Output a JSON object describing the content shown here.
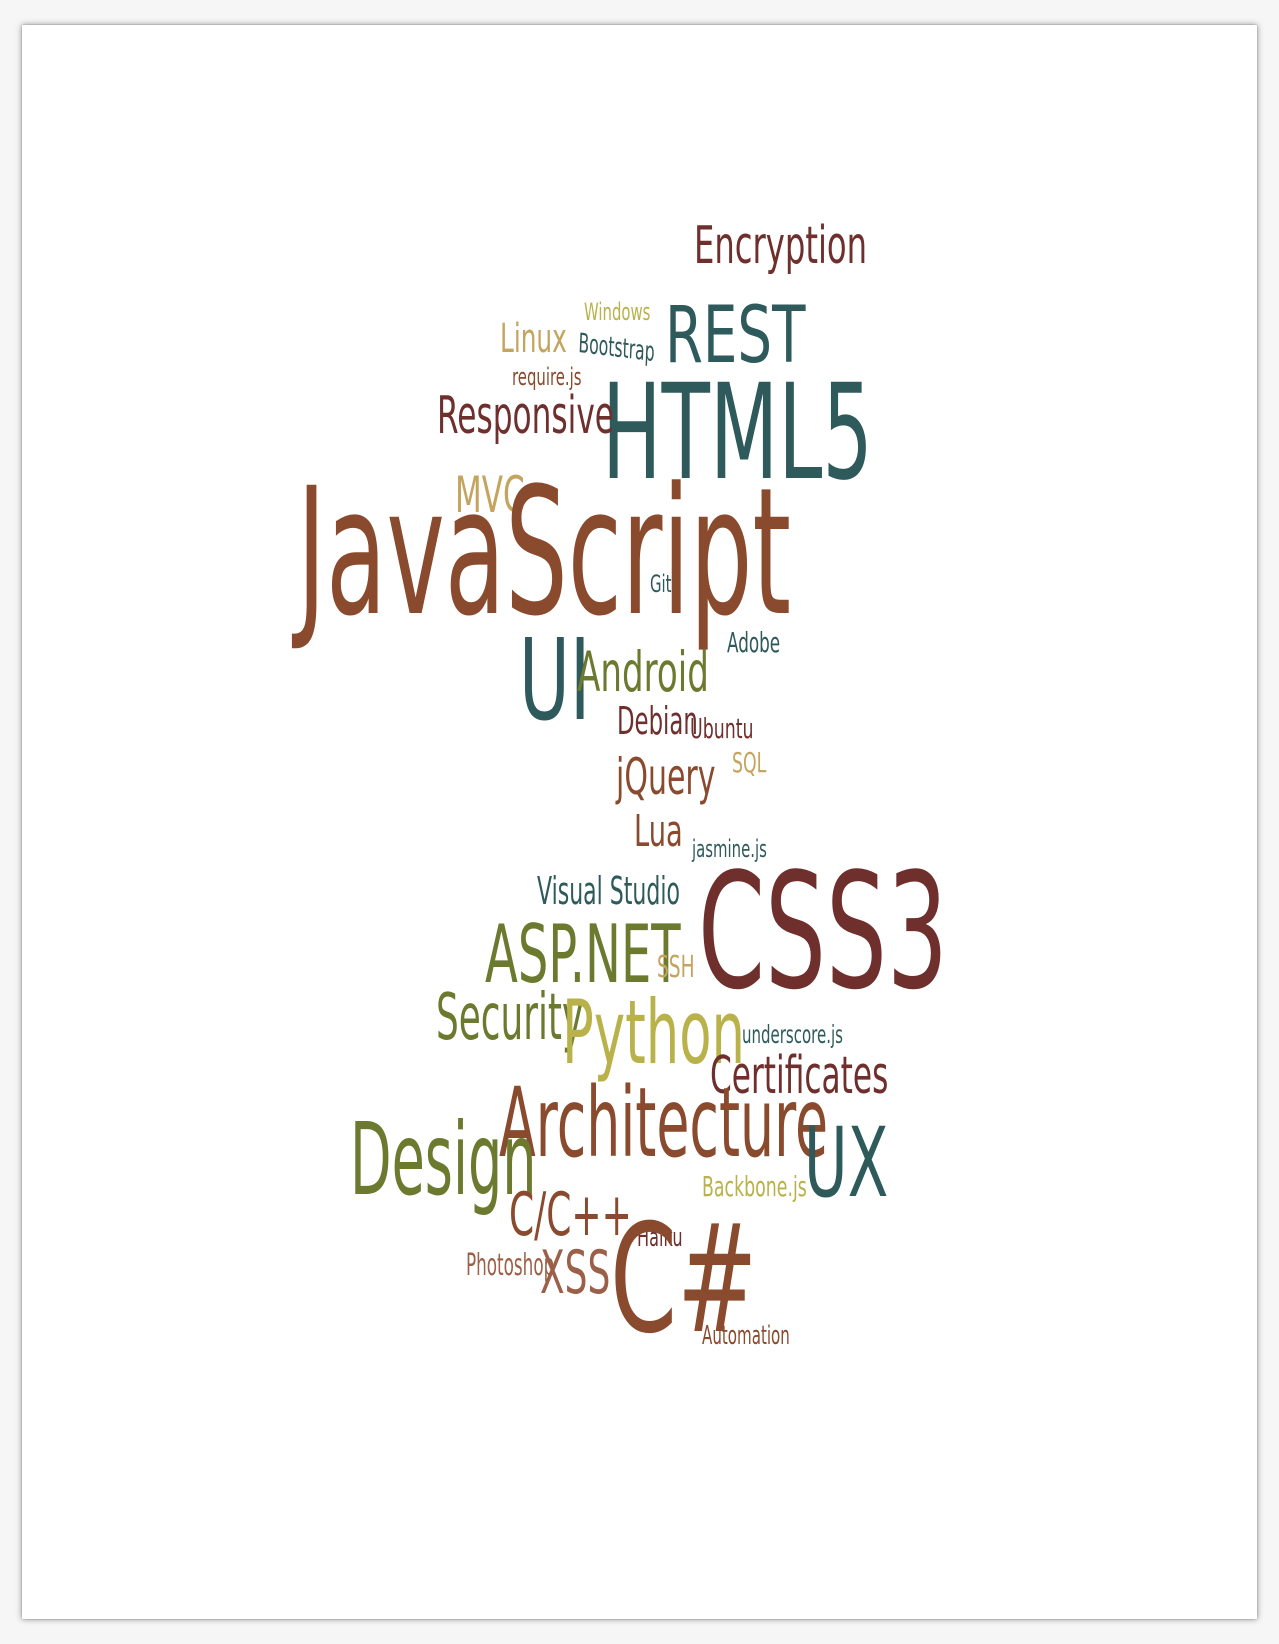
{
  "palette": {
    "brown": "#8a4a2e",
    "maroon": "#6e2f2d",
    "teal": "#2f5a5c",
    "olive": "#6b7a2e",
    "olive_light": "#b9b24a",
    "tan": "#c4a45e",
    "light_brown": "#9c5f48"
  },
  "words": {
    "encryption": "Encryption",
    "windows": "Windows",
    "rest": "REST",
    "linux": "Linux",
    "bootstrap": "Bootstrap",
    "require_js": "require.js",
    "html5": "HTML5",
    "responsive": "Responsive",
    "mvc": "MVC",
    "javascript": "JavaScript",
    "git": "Git",
    "adobe": "Adobe",
    "ui": "UI",
    "android": "Android",
    "debian": "Debian",
    "ubuntu": "Ubuntu",
    "sql": "SQL",
    "jquery": "jQuery",
    "lua": "Lua",
    "jasmine_js": "jasmine.js",
    "visual_studio": "Visual Studio",
    "css3": "CSS3",
    "asp_net": "ASP.NET",
    "ssh": "SSH",
    "security": "Security",
    "python": "Python",
    "underscore_js": "underscore.js",
    "certificates": "Certificates",
    "architecture": "Architecture",
    "design": "Design",
    "ux": "UX",
    "backbone_js": "Backbone.js",
    "c_cpp": "C/C++",
    "haiku": "Haiku",
    "photoshop": "Photoshop",
    "xss": "XSS",
    "csharp": "C#",
    "automation": "Automation"
  }
}
